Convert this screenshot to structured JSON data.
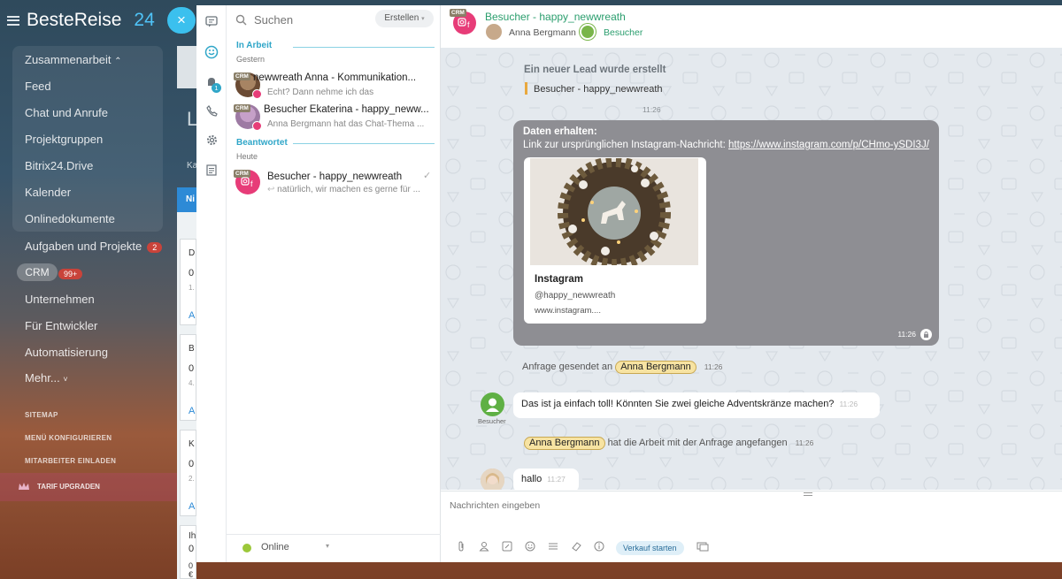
{
  "portal": {
    "brand_name": "BesteReise",
    "brand_num": "24",
    "collab_label": "Zusammenarbeit",
    "collab_caret": "⌃",
    "items": [
      {
        "label": "Feed"
      },
      {
        "label": "Chat und Anrufe"
      },
      {
        "label": "Projektgruppen"
      },
      {
        "label": "Bitrix24.Drive"
      },
      {
        "label": "Kalender"
      },
      {
        "label": "Onlinedokumente"
      }
    ],
    "tasks_label": "Aufgaben und Projekte",
    "tasks_badge": "2",
    "crm_label": "CRM",
    "crm_badge": "99+",
    "more_items": [
      {
        "label": "Unternehmen"
      },
      {
        "label": "Für Entwickler"
      },
      {
        "label": "Automatisierung"
      }
    ],
    "more_label": "Mehr...",
    "sitemap": "SITEMAP",
    "configure": "MENÜ KONFIGURIEREN",
    "invite": "MITARBEITER EINLADEN",
    "upgrade": "TARIF UPGRADEN"
  },
  "background_page": {
    "letter_top": "L",
    "letter_ka": "Ka",
    "col_head": "Ni",
    "cards": [
      {
        "a": "D",
        "b": "0",
        "c": "1.",
        "d": "A"
      },
      {
        "a": "B",
        "b": "0",
        "c": "4.",
        "d": "A"
      },
      {
        "a": "K",
        "b": "0",
        "c": "2.",
        "d": "A"
      },
      {
        "a": "Ih",
        "b": "0",
        "c": "",
        "d": ""
      }
    ],
    "bottom_value": "0 €"
  },
  "close_icon": "×",
  "iconbar": {
    "items": [
      {
        "name": "chat-icon",
        "glyph": "▭"
      },
      {
        "name": "openlines-icon",
        "glyph": "◔"
      },
      {
        "name": "notifications-icon",
        "glyph": "♪"
      },
      {
        "name": "phone-icon",
        "glyph": "✆"
      },
      {
        "name": "settings-icon",
        "glyph": "⚙"
      },
      {
        "name": "tasks-icon",
        "glyph": "☰"
      }
    ],
    "notif_badge": "1"
  },
  "recent": {
    "search_placeholder": "Suchen",
    "create_label": "Erstellen",
    "section1_title": "In Arbeit",
    "section1_sub": "Gestern",
    "section2_title": "Beantwortet",
    "section2_sub": "Heute",
    "crm_tag": "CRM",
    "items": [
      {
        "name": "newwreath Anna - Kommunikation...",
        "preview": "Echt? Dann nehme ich das"
      },
      {
        "name": "Besucher Ekaterina - happy_neww...",
        "preview": "Anna Bergmann hat das Chat-Thema ..."
      },
      {
        "name": "Besucher - happy_newwreath",
        "preview": "natürlich, wir machen es gerne für ..."
      }
    ],
    "status_label": "Online"
  },
  "chat": {
    "title": "Besucher - happy_newwreath",
    "user1": "Anna Bergmann",
    "user2": "Besucher",
    "sys_title": "Ein neuer Lead wurde erstellt",
    "sys_text": "Besucher - happy_newwreath",
    "sys_time": "11:26",
    "ig_title": "Daten erhalten:",
    "ig_link_prefix": "Link zur ursprünglichen Instagram-Nachricht:",
    "ig_link": "https://www.instagram.com/p/CHmo-ySDI3J/",
    "ig_preview_title": "Instagram",
    "ig_preview_handle": "@happy_newwreath",
    "ig_preview_url": "www.instagram....",
    "ig_time": "11:26",
    "note1_prefix": "Anfrage gesendet an",
    "note1_name": "Anna Bergmann",
    "note1_time": "11:26",
    "visitor_label": "Besucher",
    "bubble1_text": "Das ist ja einfach toll! Könnten Sie zwei gleiche Adventskränze machen?",
    "bubble1_time": "11:26",
    "note2_name": "Anna Bergmann",
    "note2_suffix": "hat die Arbeit mit der Anfrage angefangen",
    "note2_time": "11:26",
    "bubble2_text": "hallo",
    "bubble2_time": "11:27",
    "composer_placeholder": "Nachrichten eingeben",
    "sale_button": "Verkauf starten",
    "toolbar_icons": [
      "paperclip-icon",
      "user-icon",
      "quote-icon",
      "smile-icon",
      "list-icon",
      "eraser-icon",
      "info-icon"
    ]
  },
  "colors": {
    "accent": "#3bc0ee",
    "green": "#2b9e6e",
    "badge_red": "#c9433a",
    "ig_card": "#8e8e93"
  }
}
